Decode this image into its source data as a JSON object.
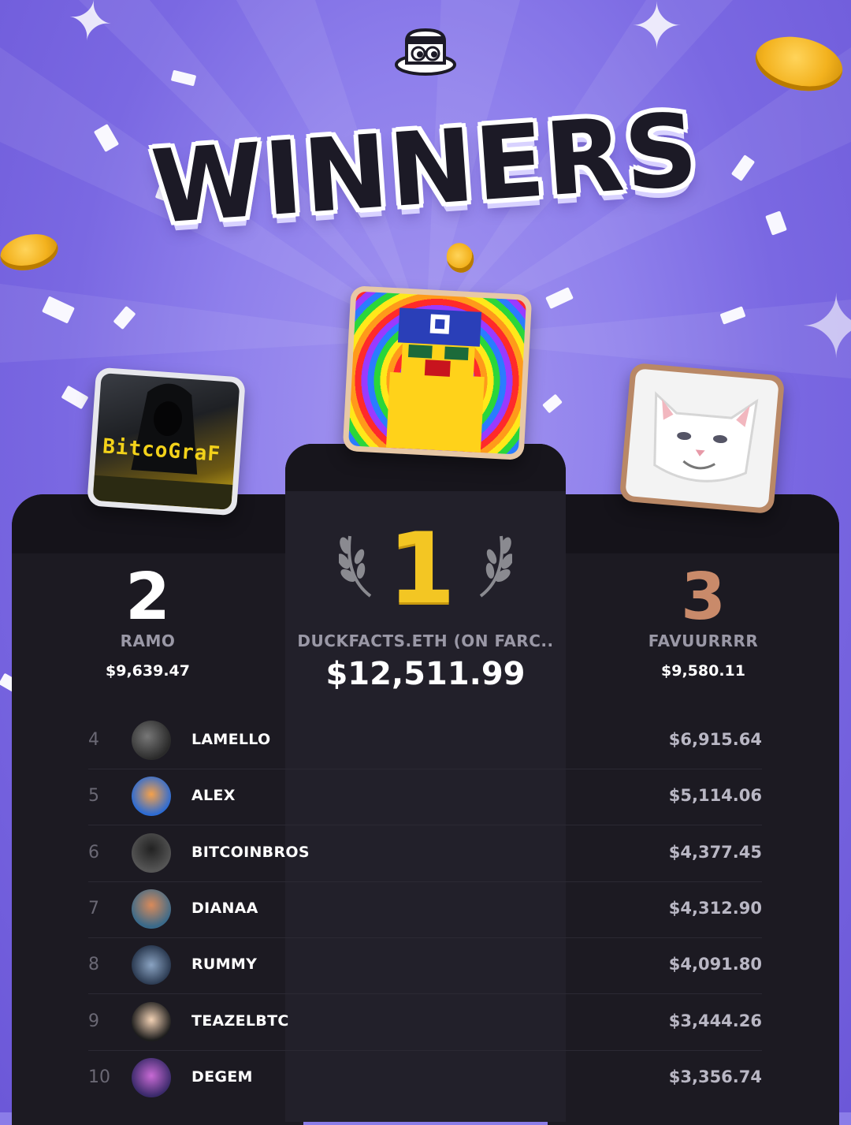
{
  "header": {
    "title": "WINNERS",
    "logo_icon": "top-hat-mascot-icon"
  },
  "colors": {
    "gold": "#f3c623",
    "silver": "#ffffff",
    "bronze": "#c98a6a",
    "podium": "#1c1a22",
    "background": "#8b7de8"
  },
  "podium": {
    "first": {
      "rank": "1",
      "name": "DUCKFACTS.ETH (ON FARC..",
      "amount": "$12,511.99"
    },
    "second": {
      "rank": "2",
      "name": "RAMO",
      "amount": "$9,639.47",
      "avatar_text": "BitcoGraF"
    },
    "third": {
      "rank": "3",
      "name": "FAVUURRRR",
      "amount": "$9,580.11"
    }
  },
  "leaderboard": [
    {
      "rank": "4",
      "name": "LAMELLO",
      "amount": "$6,915.64"
    },
    {
      "rank": "5",
      "name": "ALEX",
      "amount": "$5,114.06"
    },
    {
      "rank": "6",
      "name": "BITCOINBROS",
      "amount": "$4,377.45"
    },
    {
      "rank": "7",
      "name": "DIANAA",
      "amount": "$4,312.90"
    },
    {
      "rank": "8",
      "name": "RUMMY",
      "amount": "$4,091.80"
    },
    {
      "rank": "9",
      "name": "TEAZELBTC",
      "amount": "$3,444.26"
    },
    {
      "rank": "10",
      "name": "DEGEM",
      "amount": "$3,356.74"
    }
  ]
}
